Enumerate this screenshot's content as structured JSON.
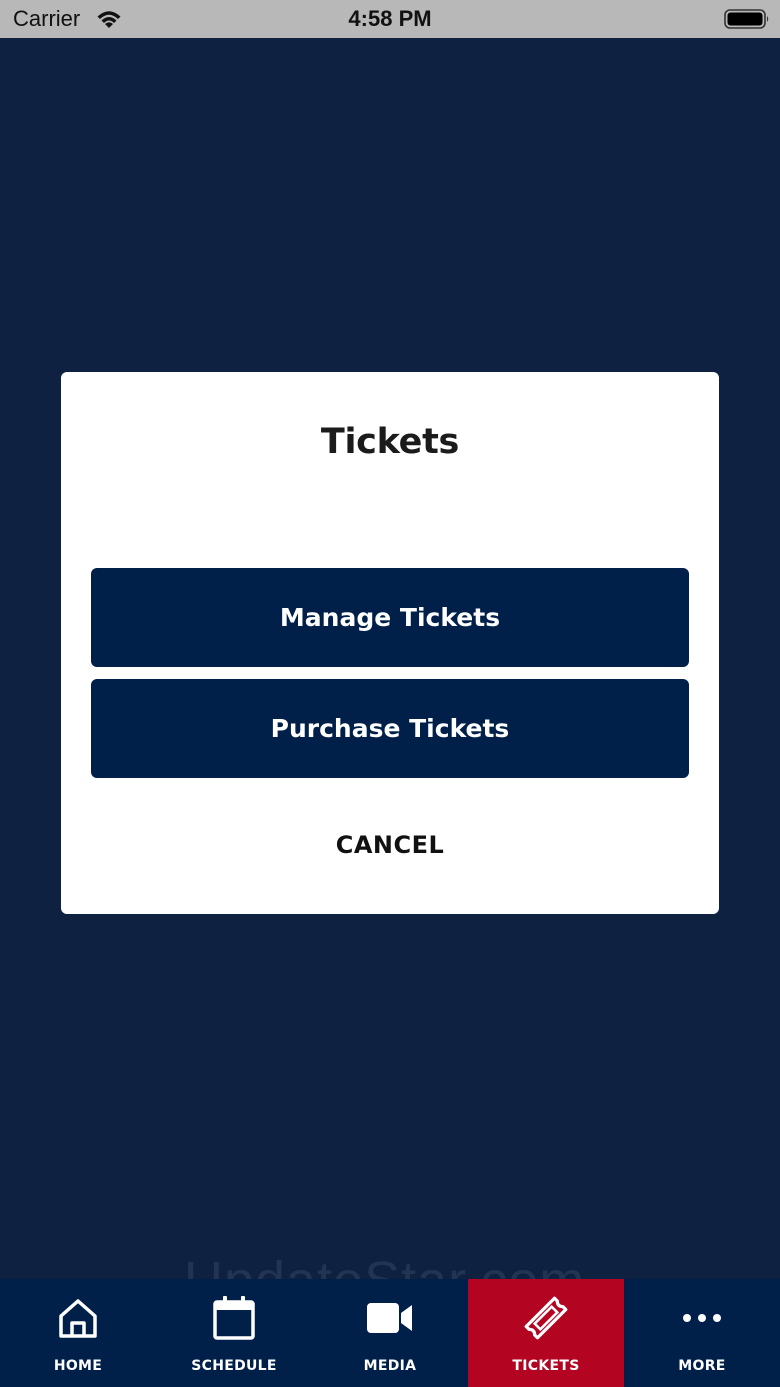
{
  "status_bar": {
    "carrier": "Carrier",
    "time": "4:58 PM"
  },
  "dialog": {
    "title": "Tickets",
    "manage_label": "Manage Tickets",
    "purchase_label": "Purchase Tickets",
    "cancel_label": "CANCEL"
  },
  "watermark": "UpdateStar.com",
  "tab_bar": {
    "active_color": "#b30422",
    "background_color": "#00204a",
    "tabs": [
      {
        "label": "HOME",
        "icon": "home-icon"
      },
      {
        "label": "SCHEDULE",
        "icon": "calendar-icon"
      },
      {
        "label": "MEDIA",
        "icon": "video-camera-icon"
      },
      {
        "label": "TICKETS",
        "icon": "ticket-icon",
        "active": true
      },
      {
        "label": "MORE",
        "icon": "more-dots-icon"
      }
    ]
  },
  "colors": {
    "backdrop": "#0e2140",
    "button": "#00204a",
    "dialog": "#ffffff"
  }
}
